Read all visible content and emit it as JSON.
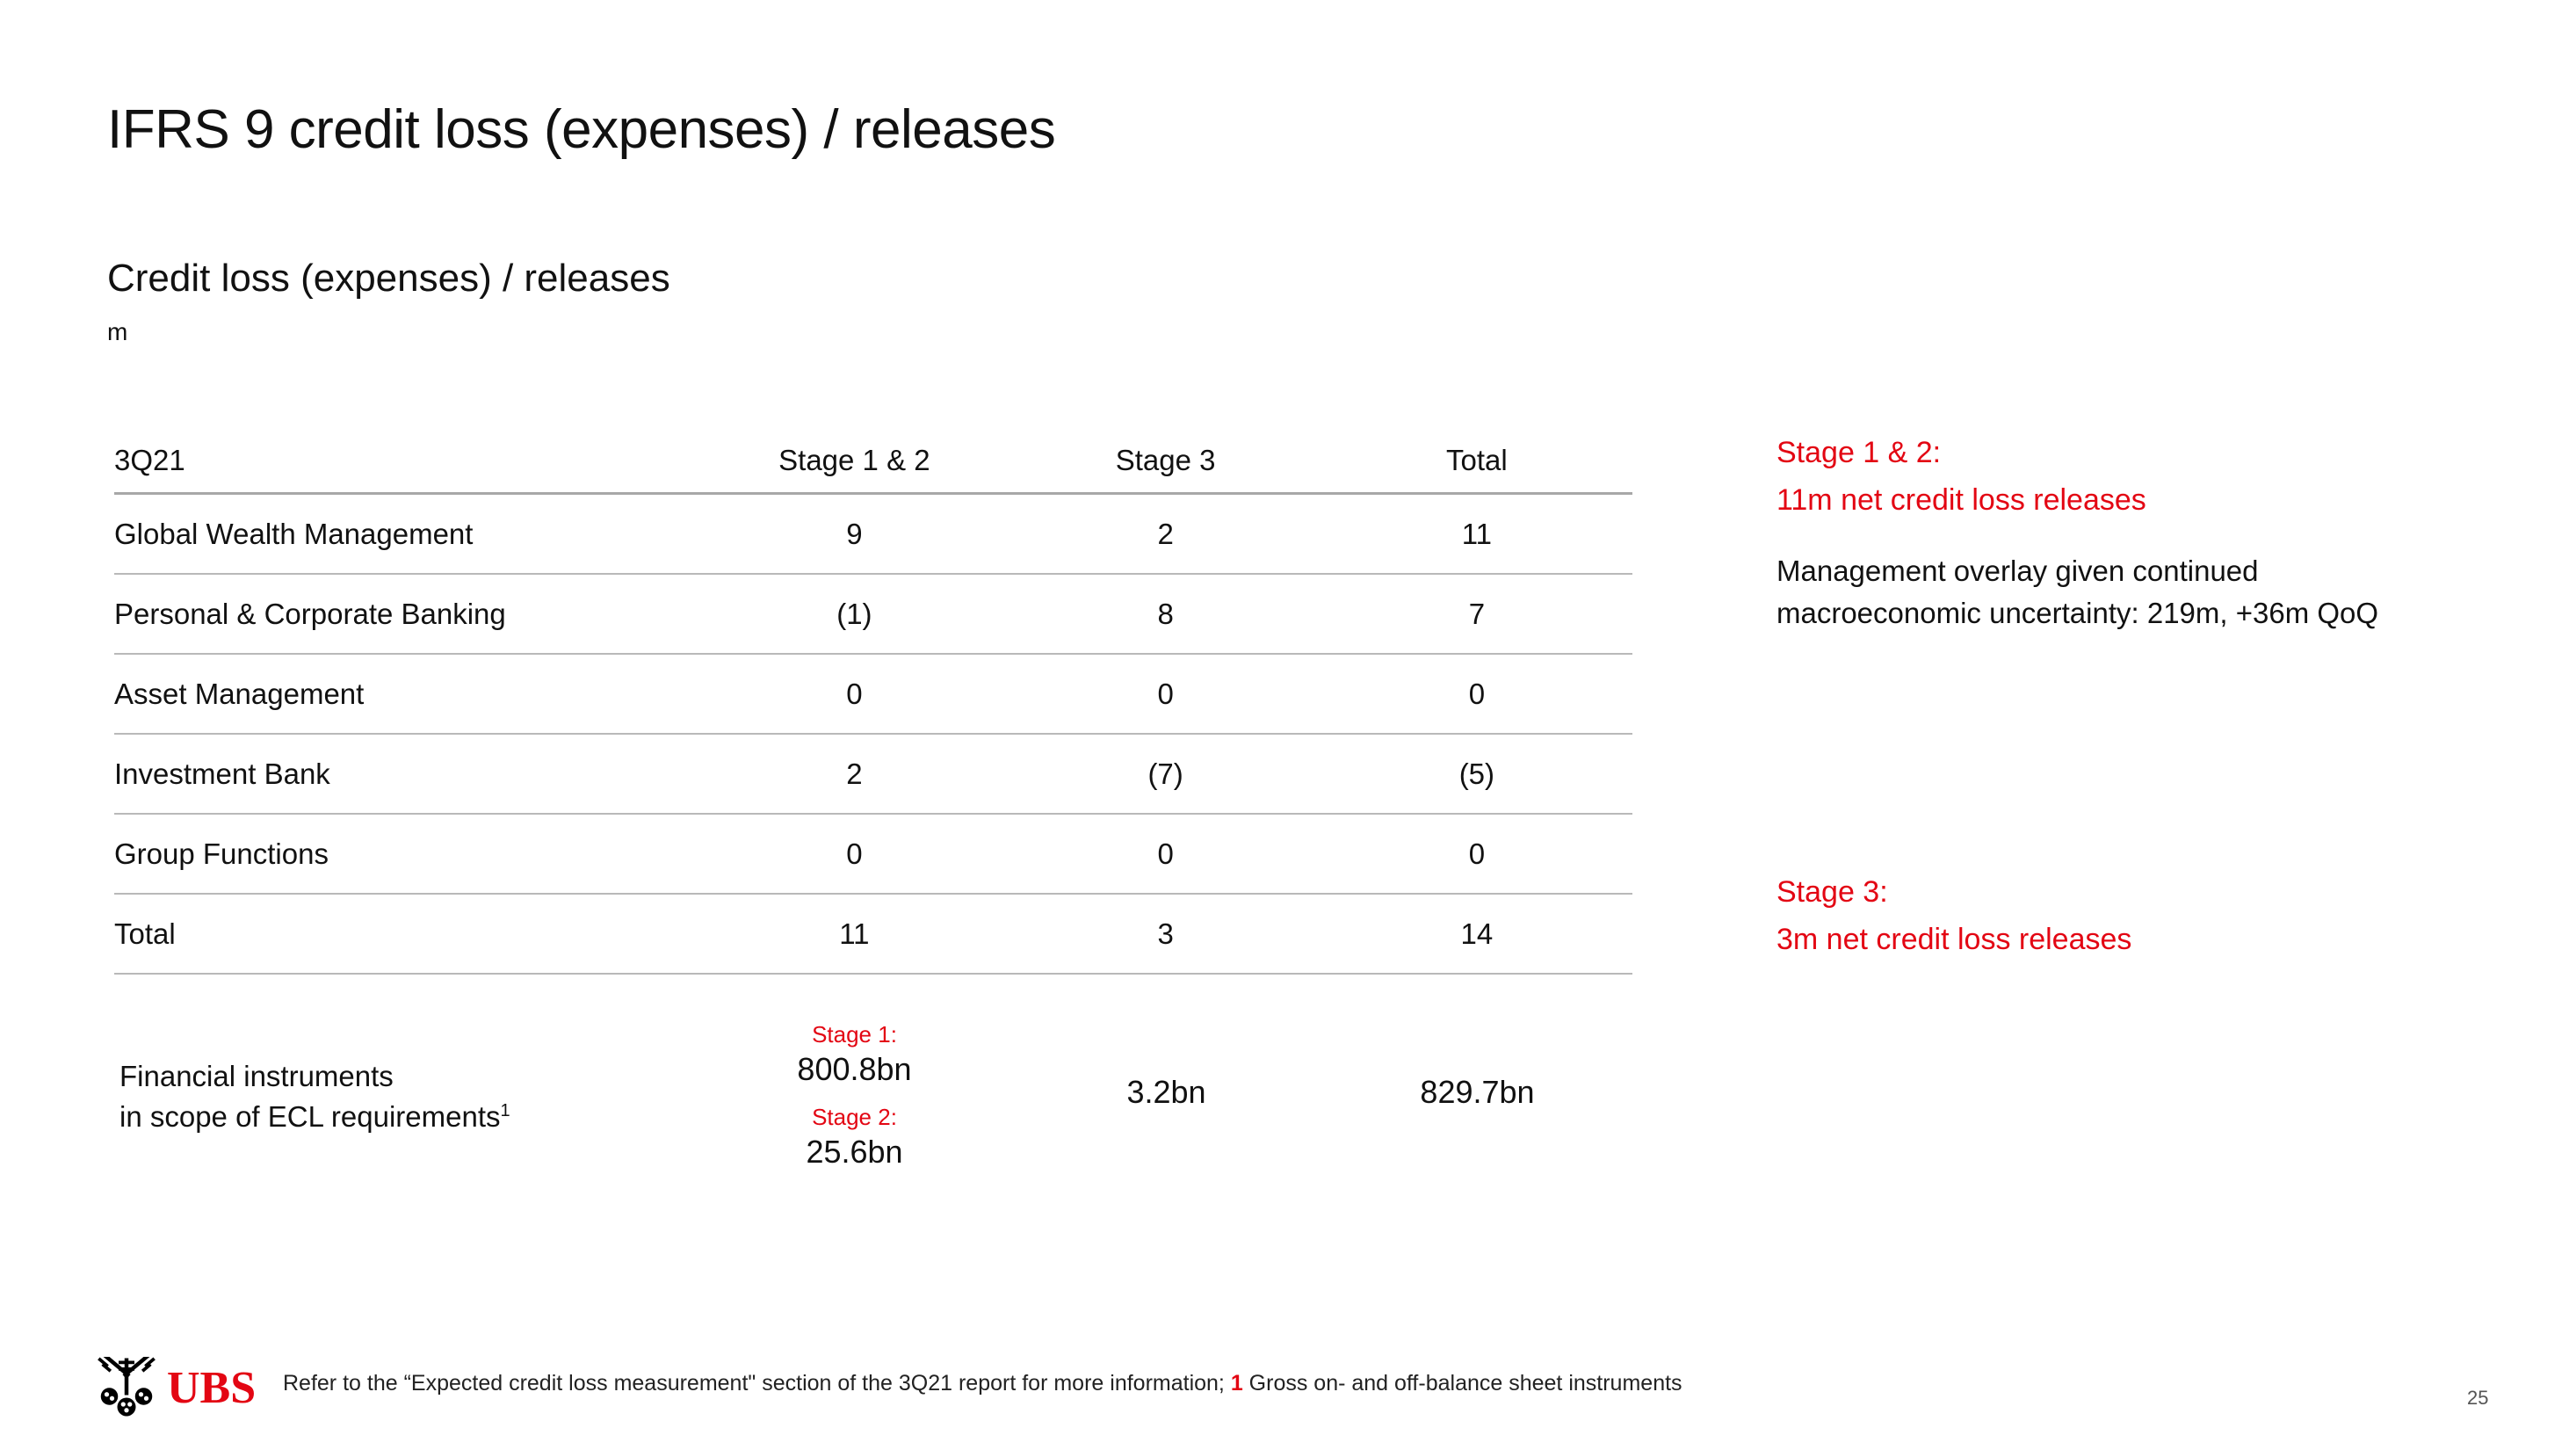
{
  "slide": {
    "title": "IFRS 9 credit loss (expenses) / releases",
    "section_title": "Credit loss (expenses) / releases",
    "unit": "m",
    "page_number": "25",
    "accent_color": "#E30613"
  },
  "table": {
    "period_label": "3Q21",
    "columns": [
      "Stage 1 & 2",
      "Stage 3",
      "Total"
    ],
    "rows": [
      {
        "label": "Global Wealth Management",
        "stage12": "9",
        "stage3": "2",
        "total": "11"
      },
      {
        "label": "Personal & Corporate Banking",
        "stage12": "(1)",
        "stage3": "8",
        "total": "7"
      },
      {
        "label": "Asset Management",
        "stage12": "0",
        "stage3": "0",
        "total": "0"
      },
      {
        "label": "Investment Bank",
        "stage12": "2",
        "stage3": "(7)",
        "total": "(5)"
      },
      {
        "label": "Group Functions",
        "stage12": "0",
        "stage3": "0",
        "total": "0"
      }
    ],
    "total_row": {
      "label": "Total",
      "stage12": "11",
      "stage3": "3",
      "total": "14"
    }
  },
  "financial_instruments": {
    "label_line1": "Financial instruments",
    "label_line2": "in scope of ECL requirements",
    "footnote_marker": "1",
    "stage1_tag": "Stage 1:",
    "stage1_value": "800.8bn",
    "stage2_tag": "Stage 2:",
    "stage2_value": "25.6bn",
    "stage3_value": "3.2bn",
    "total_value": "829.7bn"
  },
  "commentary": {
    "block1": {
      "head_line1": "Stage 1 & 2:",
      "head_line2": "11m net credit loss releases",
      "body_line1": "Management overlay given continued",
      "body_line2": "macroeconomic uncertainty: 219m, +36m QoQ"
    },
    "block2": {
      "head_line1": "Stage 3:",
      "head_line2": "3m net credit loss releases"
    }
  },
  "footer": {
    "brand": "UBS",
    "note_part1": "Refer to the “Expected credit loss measurement\" section of the 3Q21 report for more information; ",
    "note_marker": "1",
    "note_part2": " Gross on- and off-balance sheet instruments"
  }
}
